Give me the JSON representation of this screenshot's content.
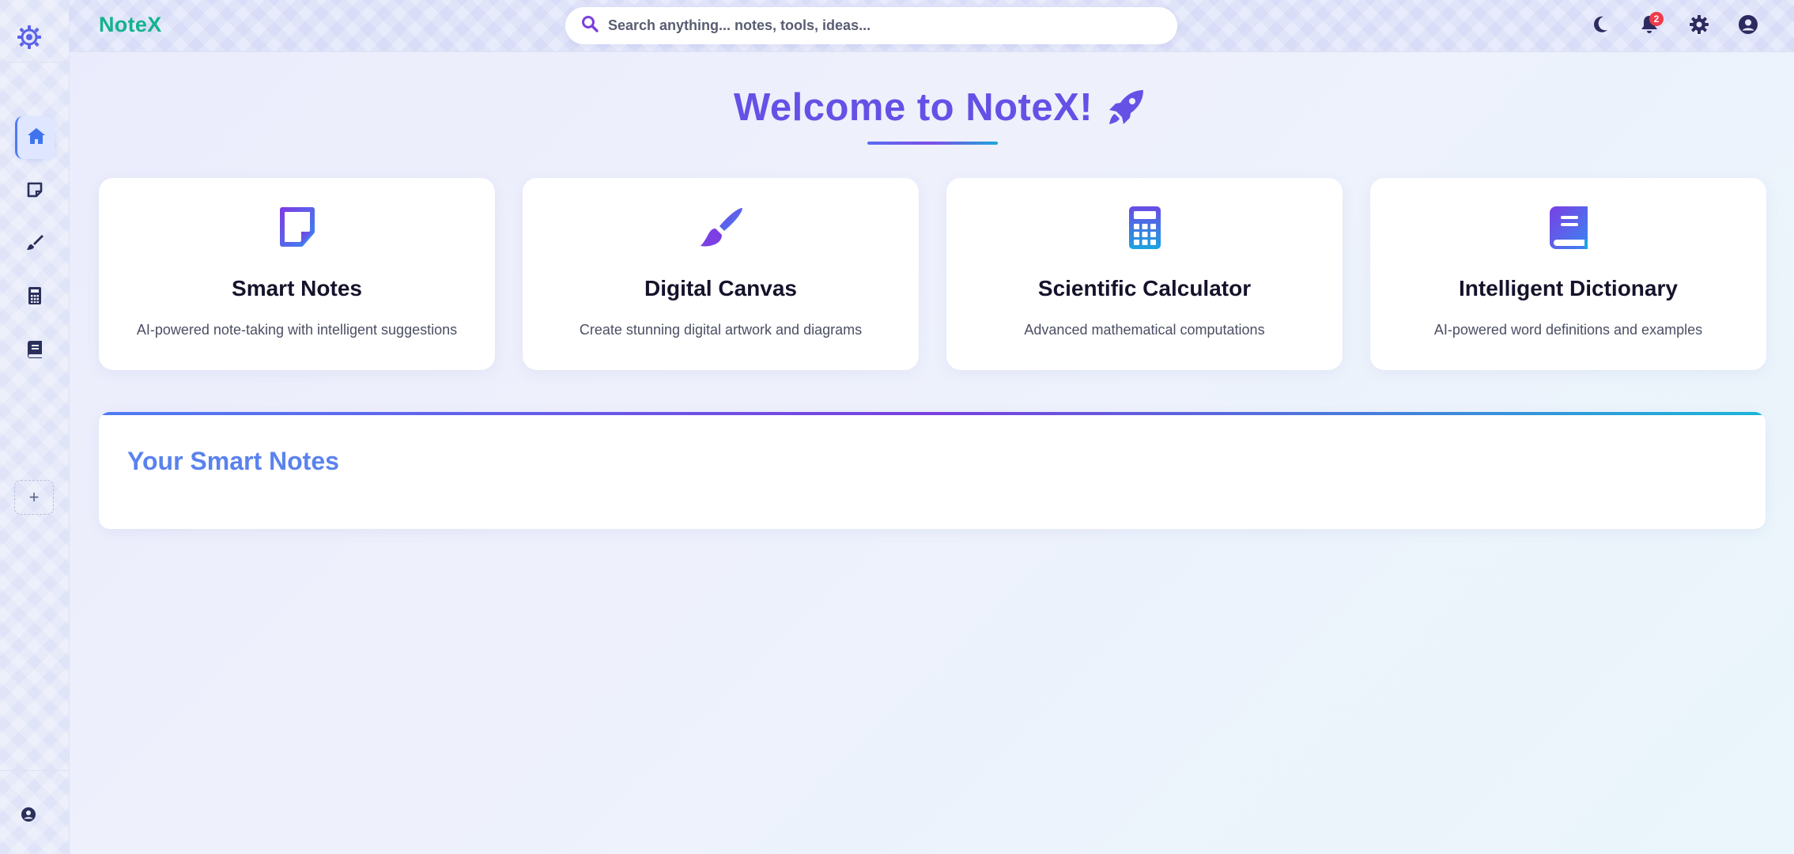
{
  "app": {
    "brand": "NoteX",
    "accent": "#6551e6",
    "brand_color": "#14b28e"
  },
  "search": {
    "placeholder": "Search anything... notes, tools, ideas...",
    "icon": "search-icon"
  },
  "header_icons": [
    {
      "name": "moon-icon",
      "label": "Dark mode"
    },
    {
      "name": "bell-icon",
      "label": "Notifications",
      "badge": "2"
    },
    {
      "name": "gear-icon",
      "label": "Settings"
    },
    {
      "name": "user-icon",
      "label": "Profile"
    }
  ],
  "sidebar": {
    "logo_icon": "gear-atom-icon",
    "items": [
      {
        "name": "home-icon",
        "active": true
      },
      {
        "name": "sticky-note-icon",
        "active": false
      },
      {
        "name": "paintbrush-icon",
        "active": false
      },
      {
        "name": "calculator-icon",
        "active": false
      },
      {
        "name": "book-icon",
        "active": false
      }
    ],
    "add_label": "+",
    "footer_icon": "user-circle-icon"
  },
  "welcome": {
    "title": "Welcome to NoteX!",
    "icon": "rocket-icon"
  },
  "cards": [
    {
      "title": "Smart Notes",
      "description": "AI-powered note-taking with intelligent suggestions",
      "icon": "sticky-note-icon"
    },
    {
      "title": "Digital Canvas",
      "description": "Create stunning digital artwork and diagrams",
      "icon": "paintbrush-icon"
    },
    {
      "title": "Scientific Calculator",
      "description": "Advanced mathematical computations",
      "icon": "calculator-icon"
    },
    {
      "title": "Intelligent Dictionary",
      "description": "AI-powered word definitions and examples",
      "icon": "book-icon"
    }
  ],
  "notes_panel": {
    "title": "Your Smart Notes"
  }
}
